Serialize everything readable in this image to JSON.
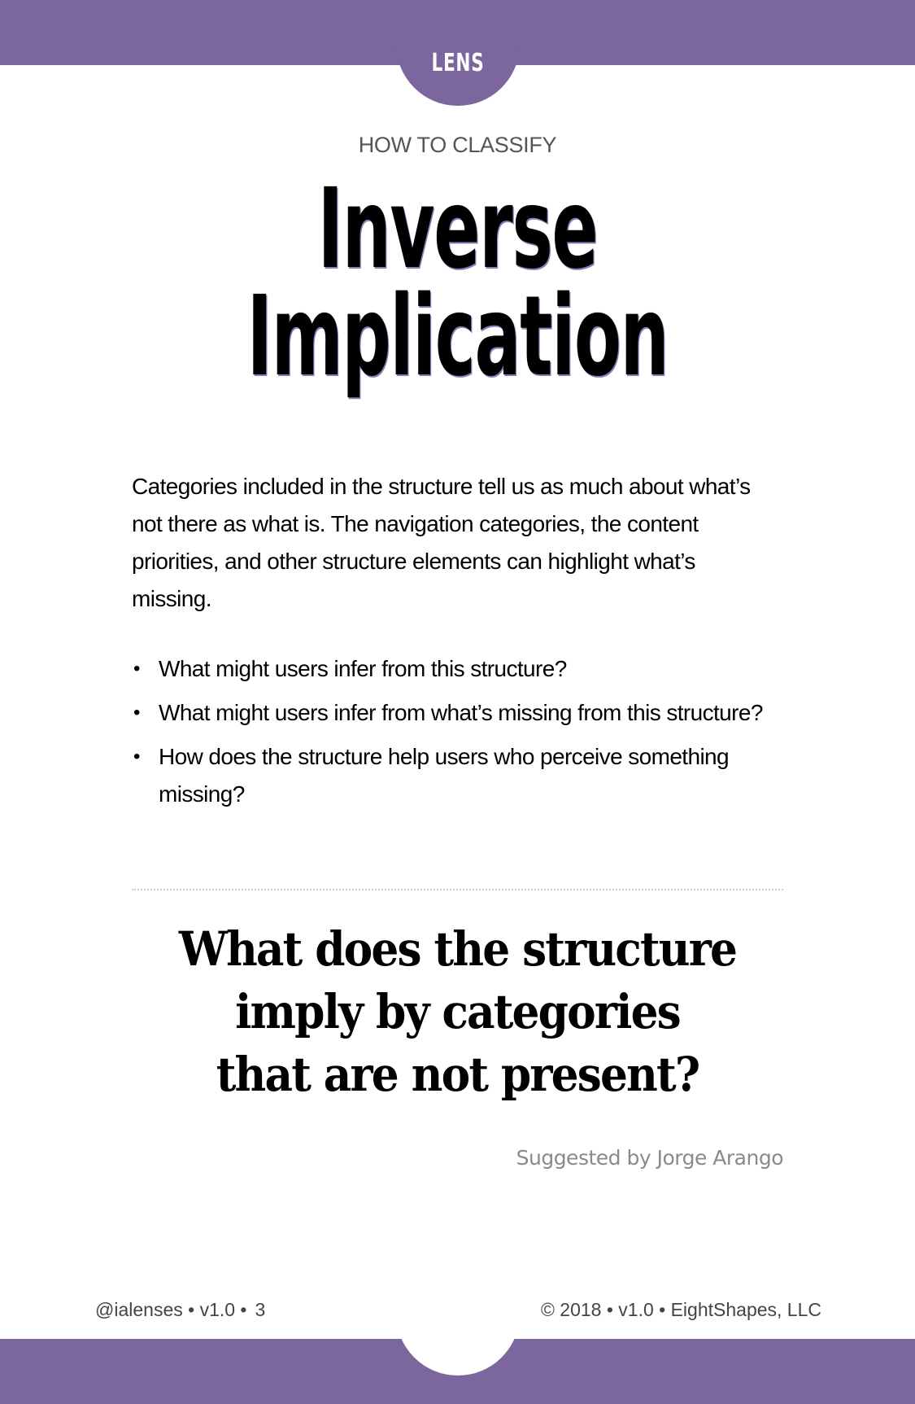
{
  "header": {
    "label": "LENS"
  },
  "card": {
    "kicker": "HOW TO CLASSIFY",
    "title_lines": [
      "Inverse",
      "Implication"
    ],
    "intro": "Categories included in the structure tell us as much about what’s not there as what is. The navigation categories, the content priorities, and other structure elements can highlight what’s missing.",
    "questions": [
      "What might users infer from this structure?",
      "What might users infer from what’s missing from this structure?",
      "How does the structure help users who perceive something missing?"
    ],
    "big_question_lines": [
      "What does the structure",
      "imply by categories",
      "that are not present?"
    ],
    "credit": "Suggested by Jorge Arango"
  },
  "footer": {
    "left": "@ialenses • v1.0 •",
    "page_number": "3",
    "right": "© 2018 • v1.0 • EightShapes, LLC"
  },
  "colors": {
    "accent": "#7b669e",
    "text": "#000000",
    "muted": "#8a8a8a"
  }
}
